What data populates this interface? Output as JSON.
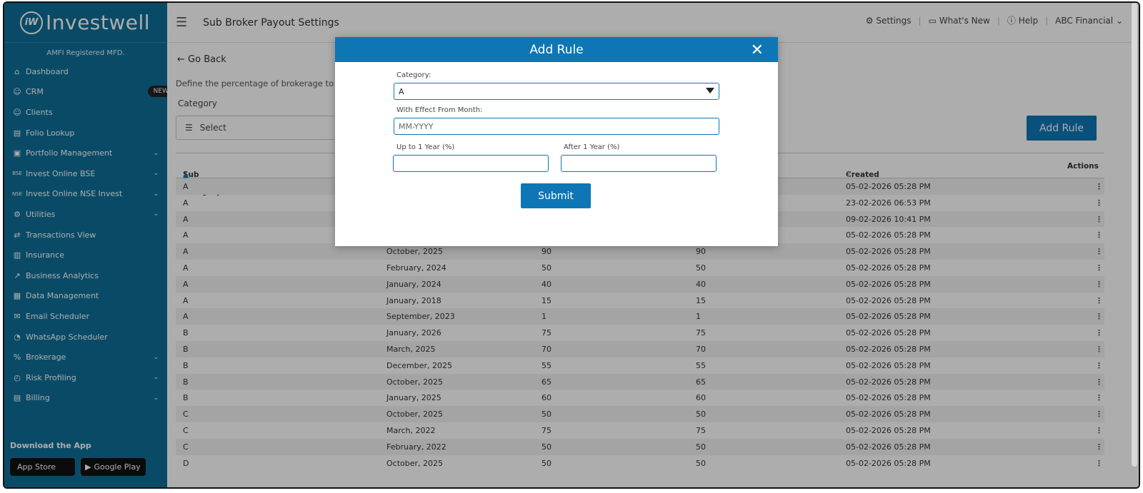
{
  "sidebar": {
    "logo_text": "Investwell",
    "logo_mark": "iW",
    "amfi": "AMFI Registered MFD.",
    "items": [
      {
        "label": "Dashboard",
        "icon": "⌂",
        "chevron": false
      },
      {
        "label": "CRM",
        "icon": "☺",
        "chevron": false,
        "badge": "NEW"
      },
      {
        "label": "Clients",
        "icon": "☺",
        "chevron": false
      },
      {
        "label": "Folio Lookup",
        "icon": "▤",
        "chevron": false
      },
      {
        "label": "Portfolio Management",
        "icon": "▣",
        "chevron": true
      },
      {
        "label": "Invest Online BSE",
        "icon": "BSE",
        "chevron": true
      },
      {
        "label": "Invest Online NSE Invest",
        "icon": "NSE",
        "chevron": true
      },
      {
        "label": "Utilities",
        "icon": "⚙",
        "chevron": true
      },
      {
        "label": "Transactions View",
        "icon": "⇄",
        "chevron": false
      },
      {
        "label": "Insurance",
        "icon": "▥",
        "chevron": false
      },
      {
        "label": "Business Analytics",
        "icon": "↗",
        "chevron": false
      },
      {
        "label": "Data Management",
        "icon": "▦",
        "chevron": false
      },
      {
        "label": "Email Scheduler",
        "icon": "✉",
        "chevron": false
      },
      {
        "label": "WhatsApp Scheduler",
        "icon": "◔",
        "chevron": false
      },
      {
        "label": "Brokerage",
        "icon": "%",
        "chevron": true
      },
      {
        "label": "Risk Profiling",
        "icon": "◴",
        "chevron": true
      },
      {
        "label": "Billing",
        "icon": "▤",
        "chevron": true
      }
    ],
    "download_label": "Download the App",
    "app_store": "App Store",
    "google_play": "Google Play"
  },
  "header": {
    "title": "Sub Broker Payout Settings",
    "settings": "Settings",
    "whats_new": "What's New",
    "help": "Help",
    "account": "ABC Financial"
  },
  "main": {
    "go_back": "Go Back",
    "define_text": "Define the percentage of brokerage to be s",
    "category_label": "Category",
    "select_placeholder": "Select",
    "add_rule_button": "Add Rule",
    "table": {
      "headers": {
        "c0": "Sub Broker Category",
        "c4": "Created At",
        "c5": "Actions"
      },
      "rows": [
        [
          "A",
          "",
          "",
          "",
          "05-02-2026 05:28 PM"
        ],
        [
          "A",
          "",
          "",
          "",
          "23-02-2026 06:53 PM"
        ],
        [
          "A",
          "",
          "",
          "",
          "09-02-2026 10:41 PM"
        ],
        [
          "A",
          "",
          "",
          "",
          "05-02-2026 05:28 PM"
        ],
        [
          "A",
          "October, 2025",
          "90",
          "90",
          "05-02-2026 05:28 PM"
        ],
        [
          "A",
          "February, 2024",
          "50",
          "50",
          "05-02-2026 05:28 PM"
        ],
        [
          "A",
          "January, 2024",
          "40",
          "40",
          "05-02-2026 05:28 PM"
        ],
        [
          "A",
          "January, 2018",
          "15",
          "15",
          "05-02-2026 05:28 PM"
        ],
        [
          "A",
          "September, 2023",
          "1",
          "1",
          "05-02-2026 05:28 PM"
        ],
        [
          "B",
          "January, 2026",
          "75",
          "75",
          "05-02-2026 05:28 PM"
        ],
        [
          "B",
          "March, 2025",
          "70",
          "70",
          "05-02-2026 05:28 PM"
        ],
        [
          "B",
          "December, 2025",
          "55",
          "55",
          "05-02-2026 05:28 PM"
        ],
        [
          "B",
          "October, 2025",
          "65",
          "65",
          "05-02-2026 05:28 PM"
        ],
        [
          "B",
          "January, 2025",
          "60",
          "60",
          "05-02-2026 05:28 PM"
        ],
        [
          "C",
          "October, 2025",
          "50",
          "50",
          "05-02-2026 05:28 PM"
        ],
        [
          "C",
          "March, 2022",
          "75",
          "75",
          "05-02-2026 05:28 PM"
        ],
        [
          "C",
          "February, 2022",
          "50",
          "50",
          "05-02-2026 05:28 PM"
        ],
        [
          "D",
          "October, 2025",
          "50",
          "50",
          "05-02-2026 05:28 PM"
        ]
      ],
      "actions_glyph": "⋮"
    }
  },
  "modal": {
    "title": "Add Rule",
    "close_glyph": "✕",
    "category_label": "Category:",
    "category_value": "A",
    "month_label": "With Effect From Month:",
    "month_placeholder": "MM-YYYY",
    "upto_label": "Up to 1 Year (%)",
    "after_label": "After 1 Year (%)",
    "submit": "Submit"
  },
  "colors": {
    "sidebar": "#0e6f99",
    "primary": "#0e76b5"
  }
}
